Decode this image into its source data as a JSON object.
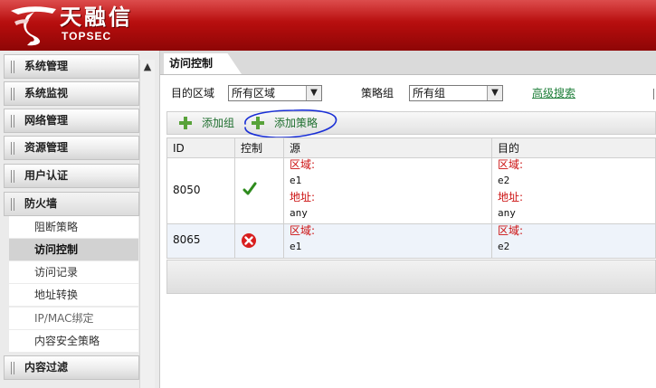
{
  "brand": {
    "name_cn": "天融信",
    "name_en": "TOPSEC",
    "color": "#c41414"
  },
  "sidebar": {
    "menus": [
      {
        "label": "系统管理",
        "icon": "grip-icon"
      },
      {
        "label": "系统监视",
        "icon": "grip-icon"
      },
      {
        "label": "网络管理",
        "icon": "grip-icon"
      },
      {
        "label": "资源管理",
        "icon": "grip-icon"
      },
      {
        "label": "用户认证",
        "icon": "grip-icon"
      },
      {
        "label": "防火墙",
        "icon": "grip-icon",
        "expanded": true
      }
    ],
    "firewall_items": [
      {
        "label": "阻断策略"
      },
      {
        "label": "访问控制",
        "selected": true
      },
      {
        "label": "访问记录"
      },
      {
        "label": "地址转换"
      },
      {
        "label": "IP/MAC绑定"
      },
      {
        "label": "内容安全策略"
      }
    ],
    "after_menu": {
      "label": "内容过滤",
      "icon": "grip-icon"
    },
    "scroll_up_icon": "▲"
  },
  "main": {
    "tab": {
      "label": "访问控制"
    },
    "filter": {
      "dest_zone_label": "目的区域",
      "dest_zone_value": "所有区域",
      "policy_group_label": "策略组",
      "policy_group_value": "所有组",
      "advanced_search": "高级搜索",
      "dropdown_arrow": "▼"
    },
    "toolbar": {
      "add_group": "添加组",
      "add_policy": "添加策略",
      "annotation_color": "#1a2fd6"
    },
    "table": {
      "headers": {
        "id": "ID",
        "control": "控制",
        "source": "源",
        "dest": "目的"
      },
      "rows": [
        {
          "id": "8050",
          "control": "allow",
          "control_color": "#2e8b1d",
          "source": {
            "zone_label": "区域:",
            "zone": "e1",
            "addr_label": "地址:",
            "addr": "any"
          },
          "dest": {
            "zone_label": "区域:",
            "zone": "e2",
            "addr_label": "地址:",
            "addr": "any"
          }
        },
        {
          "id": "8065",
          "control": "deny",
          "control_color": "#d81e1e",
          "source": {
            "zone_label": "区域:",
            "zone": "e1"
          },
          "dest": {
            "zone_label": "区域:",
            "zone": "e2"
          }
        }
      ]
    }
  }
}
